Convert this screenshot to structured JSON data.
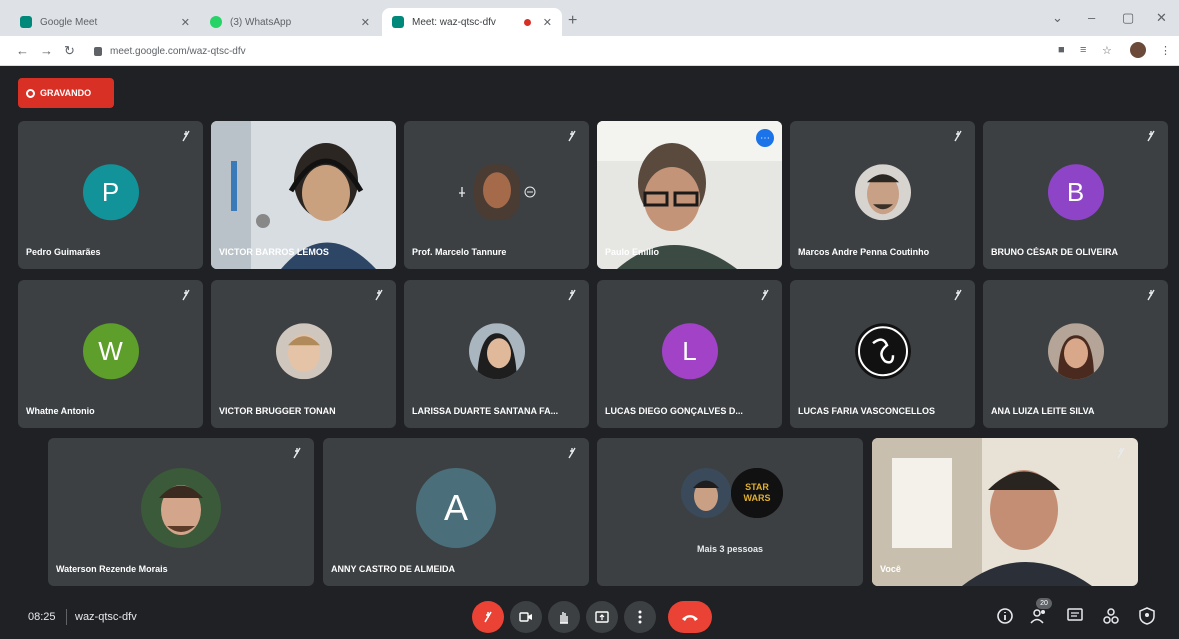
{
  "browser": {
    "tabs": [
      {
        "label": "Google Meet",
        "favicon_color": "#00897b",
        "active": false
      },
      {
        "label": "(3) WhatsApp",
        "favicon_color": "#25d366",
        "active": false
      },
      {
        "label": "Meet: waz-qtsc-dfv",
        "favicon_color": "#00897b",
        "active": true
      }
    ],
    "url": "meet.google.com/waz-qtsc-dfv"
  },
  "meeting": {
    "recording_label": "GRAVANDO",
    "time": "08:25",
    "code": "waz-qtsc-dfv",
    "participants_count": "20"
  },
  "tiles": [
    {
      "name": "Pedro Guimarães",
      "initial": "P",
      "avatar_color": "#12939a"
    },
    {
      "name": "VICTOR BARROS LEMOS"
    },
    {
      "name": "Prof. Marcelo Tannure"
    },
    {
      "name": "Paulo Emílio"
    },
    {
      "name": "Marcos Andre Penna Coutinho"
    },
    {
      "name": "BRUNO CÉSAR DE OLIVEIRA",
      "initial": "B",
      "avatar_color": "#8e44c7"
    },
    {
      "name": "Whatne Antonio",
      "initial": "W",
      "avatar_color": "#5e9e2a"
    },
    {
      "name": "VICTOR BRUGGER TONAN"
    },
    {
      "name": "LARISSA DUARTE SANTANA FA..."
    },
    {
      "name": "LUCAS DIEGO GONÇALVES D...",
      "initial": "L",
      "avatar_color": "#a142c7"
    },
    {
      "name": "LUCAS FARIA VASCONCELLOS"
    },
    {
      "name": "ANA LUIZA LEITE SILVA"
    },
    {
      "name": "Waterson Rezende Morais"
    },
    {
      "name": "ANNY CASTRO DE ALMEIDA",
      "initial": "A",
      "avatar_color": "#4a6f7a"
    },
    {
      "name": "Mais 3 pessoas"
    },
    {
      "name": "Você"
    }
  ]
}
